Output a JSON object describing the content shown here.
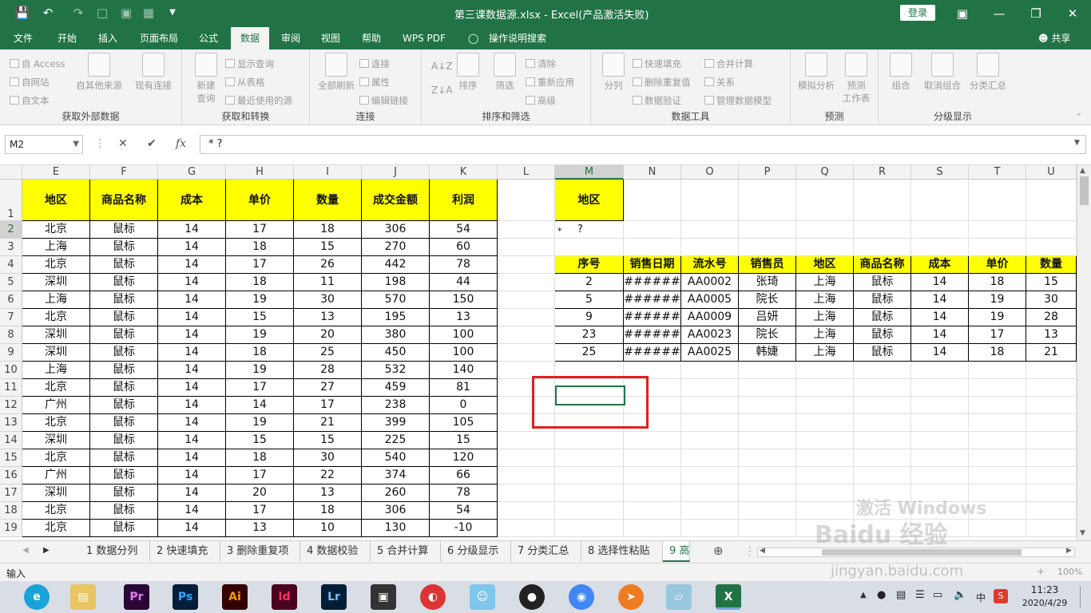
{
  "window": {
    "title": "第三课数据源.xlsx  -  Excel(产品激活失败)",
    "login": "登录",
    "share": "共享"
  },
  "tabs": [
    "文件",
    "开始",
    "插入",
    "页面布局",
    "公式",
    "数据",
    "审阅",
    "视图",
    "帮助",
    "WPS PDF",
    "操作说明搜索"
  ],
  "ribbon": {
    "get_external": {
      "label": "获取外部数据",
      "access": "自 Access",
      "web": "自网站",
      "text": "自文本",
      "other": "自其他来源",
      "existing": "现有连接"
    },
    "get_transform": {
      "label": "获取和转换",
      "new_query": "新建\n查询",
      "show_query": "显示查询",
      "from_table": "从表格",
      "recent": "最近使用的源"
    },
    "connections": {
      "label": "连接",
      "refresh_all": "全部刷新",
      "conn": "连接",
      "props": "属性",
      "edit_links": "编辑链接"
    },
    "sort_filter": {
      "label": "排序和筛选",
      "sort": "排序",
      "filter": "筛选",
      "clear": "清除",
      "reapply": "重新应用",
      "advanced": "高级"
    },
    "data_tools": {
      "label": "数据工具",
      "split": "分列",
      "flash_fill": "快速填充",
      "remove_dup": "删除重复值",
      "validation": "数据验证",
      "consolidate": "合并计算",
      "relations": "关系",
      "data_model": "管理数据模型"
    },
    "forecast": {
      "label": "预测",
      "what_if": "模拟分析",
      "sheet": "预测\n工作表"
    },
    "outline": {
      "label": "分级显示",
      "group": "组合",
      "ungroup": "取消组合",
      "subtotal": "分类汇总"
    }
  },
  "formula": {
    "namebox": "M2",
    "fx": "fx",
    "content": "*  ?"
  },
  "columns": [
    "E",
    "F",
    "G",
    "H",
    "I",
    "J",
    "K",
    "L",
    "M",
    "N",
    "O",
    "P",
    "Q",
    "R",
    "S",
    "T",
    "U"
  ],
  "rows": [
    "1",
    "2",
    "3",
    "4",
    "5",
    "6",
    "7",
    "8",
    "9",
    "10",
    "11",
    "12",
    "13",
    "14",
    "15",
    "16",
    "17",
    "18",
    "19"
  ],
  "left_table": {
    "headers": [
      "地区",
      "商品名称",
      "成本",
      "单价",
      "数量",
      "成交金额",
      "利润"
    ],
    "data": [
      [
        "北京",
        "鼠标",
        "14",
        "17",
        "18",
        "306",
        "54"
      ],
      [
        "上海",
        "鼠标",
        "14",
        "18",
        "15",
        "270",
        "60"
      ],
      [
        "北京",
        "鼠标",
        "14",
        "17",
        "26",
        "442",
        "78"
      ],
      [
        "深圳",
        "鼠标",
        "14",
        "18",
        "11",
        "198",
        "44"
      ],
      [
        "上海",
        "鼠标",
        "14",
        "19",
        "30",
        "570",
        "150"
      ],
      [
        "北京",
        "鼠标",
        "14",
        "15",
        "13",
        "195",
        "13"
      ],
      [
        "深圳",
        "鼠标",
        "14",
        "19",
        "20",
        "380",
        "100"
      ],
      [
        "深圳",
        "鼠标",
        "14",
        "18",
        "25",
        "450",
        "100"
      ],
      [
        "上海",
        "鼠标",
        "14",
        "19",
        "28",
        "532",
        "140"
      ],
      [
        "北京",
        "鼠标",
        "14",
        "17",
        "27",
        "459",
        "81"
      ],
      [
        "广州",
        "鼠标",
        "14",
        "14",
        "17",
        "238",
        "0"
      ],
      [
        "北京",
        "鼠标",
        "14",
        "19",
        "21",
        "399",
        "105"
      ],
      [
        "深圳",
        "鼠标",
        "14",
        "15",
        "15",
        "225",
        "15"
      ],
      [
        "北京",
        "鼠标",
        "14",
        "18",
        "30",
        "540",
        "120"
      ],
      [
        "广州",
        "鼠标",
        "14",
        "17",
        "22",
        "374",
        "66"
      ],
      [
        "深圳",
        "鼠标",
        "14",
        "20",
        "13",
        "260",
        "78"
      ],
      [
        "北京",
        "鼠标",
        "14",
        "17",
        "18",
        "306",
        "54"
      ],
      [
        "北京",
        "鼠标",
        "14",
        "13",
        "10",
        "130",
        "-10"
      ]
    ]
  },
  "criteria": {
    "header": "地区",
    "value_star": "*",
    "value_q": "?"
  },
  "result_table": {
    "headers": [
      "序号",
      "销售日期",
      "流水号",
      "销售员",
      "地区",
      "商品名称",
      "成本",
      "单价",
      "数量"
    ],
    "data": [
      [
        "2",
        "######",
        "AA0002",
        "张琦",
        "上海",
        "鼠标",
        "14",
        "18",
        "15"
      ],
      [
        "5",
        "######",
        "AA0005",
        "院长",
        "上海",
        "鼠标",
        "14",
        "19",
        "30"
      ],
      [
        "9",
        "######",
        "AA0009",
        "吕妍",
        "上海",
        "鼠标",
        "14",
        "19",
        "28"
      ],
      [
        "23",
        "######",
        "AA0023",
        "院长",
        "上海",
        "鼠标",
        "14",
        "17",
        "13"
      ],
      [
        "25",
        "######",
        "AA0025",
        "韩婕",
        "上海",
        "鼠标",
        "14",
        "18",
        "21"
      ]
    ]
  },
  "sheets": [
    "1 数据分列",
    "2 快速填充",
    "3 删除重复项",
    "4 数据校验",
    "5 合并计算",
    "6 分级显示",
    "7 分类汇总",
    "8 选择性粘贴",
    "9 高"
  ],
  "status": {
    "mode": "输入",
    "zoom": "100%"
  },
  "taskbar": {
    "apps": [
      "Pr",
      "Ps",
      "Ai",
      "Id",
      "Lr"
    ],
    "time": "11:23",
    "date": "2020/4/29",
    "ime": "中"
  },
  "watermark": {
    "line1": "激活 Windows",
    "baidu": "Baidu 经验",
    "url": "jingyan.baidu.com"
  },
  "colors": {
    "excel_green": "#217346",
    "header_yellow": "#ffff00",
    "red_box": "#e02020"
  }
}
